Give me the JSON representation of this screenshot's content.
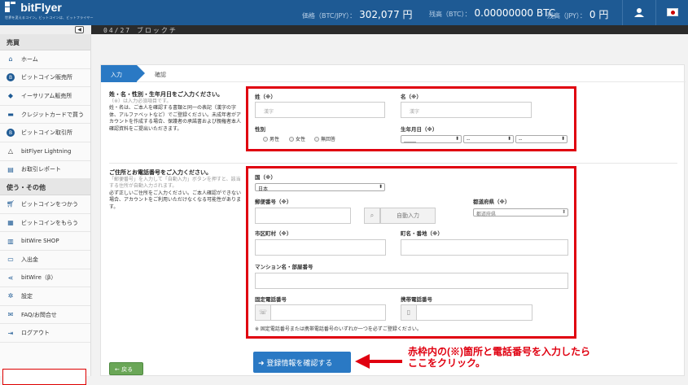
{
  "brand": {
    "name": "bitFlyer",
    "tagline": "世界を変えるコイン。ビットコインは、ビットフライヤー"
  },
  "header": {
    "price_label": "価格（BTC/JPY）：",
    "price_value": "302,077 円",
    "btc_label": "残高（BTC）：",
    "btc_value": "0.00000000 BTC",
    "jpy_label": "残高（JPY）：",
    "jpy_value": "0 円",
    "user_icon": "user-icon",
    "flag_icon": "japan-flag-icon"
  },
  "subbar": {
    "ticker": "04/27 ブロックチ",
    "collapse_icon": "collapse-left-icon"
  },
  "sidebar": {
    "sections": [
      {
        "title": "売買",
        "items": [
          {
            "label": "ホーム",
            "icon": "home-icon"
          },
          {
            "label": "ビットコイン販売所",
            "icon": "bitcoin-icon"
          },
          {
            "label": "イーサリアム販売所",
            "icon": "ethereum-icon"
          },
          {
            "label": "クレジットカードで買う",
            "icon": "credit-card-icon"
          },
          {
            "label": "ビットコイン取引所",
            "icon": "bitcoin-icon"
          },
          {
            "label": "bitFlyer Lightning",
            "icon": "lightning-triangle-icon"
          },
          {
            "label": "お取引レポート",
            "icon": "report-icon"
          }
        ]
      },
      {
        "title": "使う・その他",
        "items": [
          {
            "label": "ビットコインをつかう",
            "icon": "cart-icon"
          },
          {
            "label": "ビットコインをもらう",
            "icon": "gift-icon"
          },
          {
            "label": "bitWire SHOP",
            "icon": "shop-icon"
          },
          {
            "label": "入出金",
            "icon": "wallet-icon"
          },
          {
            "label": "bitWire（β）",
            "icon": "share-icon"
          },
          {
            "label": "設定",
            "icon": "gear-icon"
          },
          {
            "label": "FAQ/お問合せ",
            "icon": "mail-icon"
          },
          {
            "label": "ログアウト",
            "icon": "logout-icon"
          }
        ]
      }
    ]
  },
  "steps": {
    "current": "入力",
    "next": "確認"
  },
  "section1": {
    "title": "姓・名・性別・生年月日をご入力ください。",
    "required_note": "（※）は入力必須項目です。",
    "body": "姓・名は、ご本人を確認する書類と同一の表記（漢字の字体、アルファベットなど）でご登録ください。未成年者がアカウントを作成する場合、保護者の承諾書および親権者本人確認資料をご提出いただきます。",
    "last_name": {
      "label": "姓（※）",
      "placeholder": "漢字"
    },
    "first_name": {
      "label": "名（※）",
      "placeholder": "漢字"
    },
    "gender": {
      "label": "性別",
      "options": [
        "男性",
        "女性",
        "無回答"
      ]
    },
    "birthdate": {
      "label": "生年月日（※）",
      "year": "_____",
      "month": "--",
      "day": "--"
    }
  },
  "section2": {
    "title": "ご住所とお電話番号をご入力ください。",
    "hint": "「郵便番号」を入力して「自動入力」ボタンを押すと、該当する住所が自動入力されます。",
    "body": "必ず正しいご住所をご入力ください。ご本人確認ができない場合、アカウントをご利用いただけなくなる可能性があります。",
    "country": {
      "label": "国（※）",
      "value": "日本"
    },
    "postal": {
      "label": "郵便番号（※）",
      "auto_button": "自動入力"
    },
    "prefecture": {
      "label": "都道府県（※）",
      "value": "都道府県"
    },
    "city": {
      "label": "市区町村（※）"
    },
    "street": {
      "label": "町名・番地（※）"
    },
    "building": {
      "label": "マンション名・部屋番号"
    },
    "landline": {
      "label": "固定電話番号"
    },
    "mobile": {
      "label": "携帯電話番号"
    },
    "phone_note": "※ 固定電話番号または携帯電話番号のいずれか一つを必ずご登録ください。"
  },
  "actions": {
    "back": "戻る",
    "confirm": "登録情報を確認する"
  },
  "annotation": {
    "line1": "赤枠内の(※)箇所と電話番号を入力したら",
    "line2": "ここをクリック。",
    "color": "#e00010"
  },
  "colors": {
    "header": "#1e5a94",
    "accent": "#2a79c4",
    "highlight": "#e00010",
    "back": "#6aa657"
  }
}
